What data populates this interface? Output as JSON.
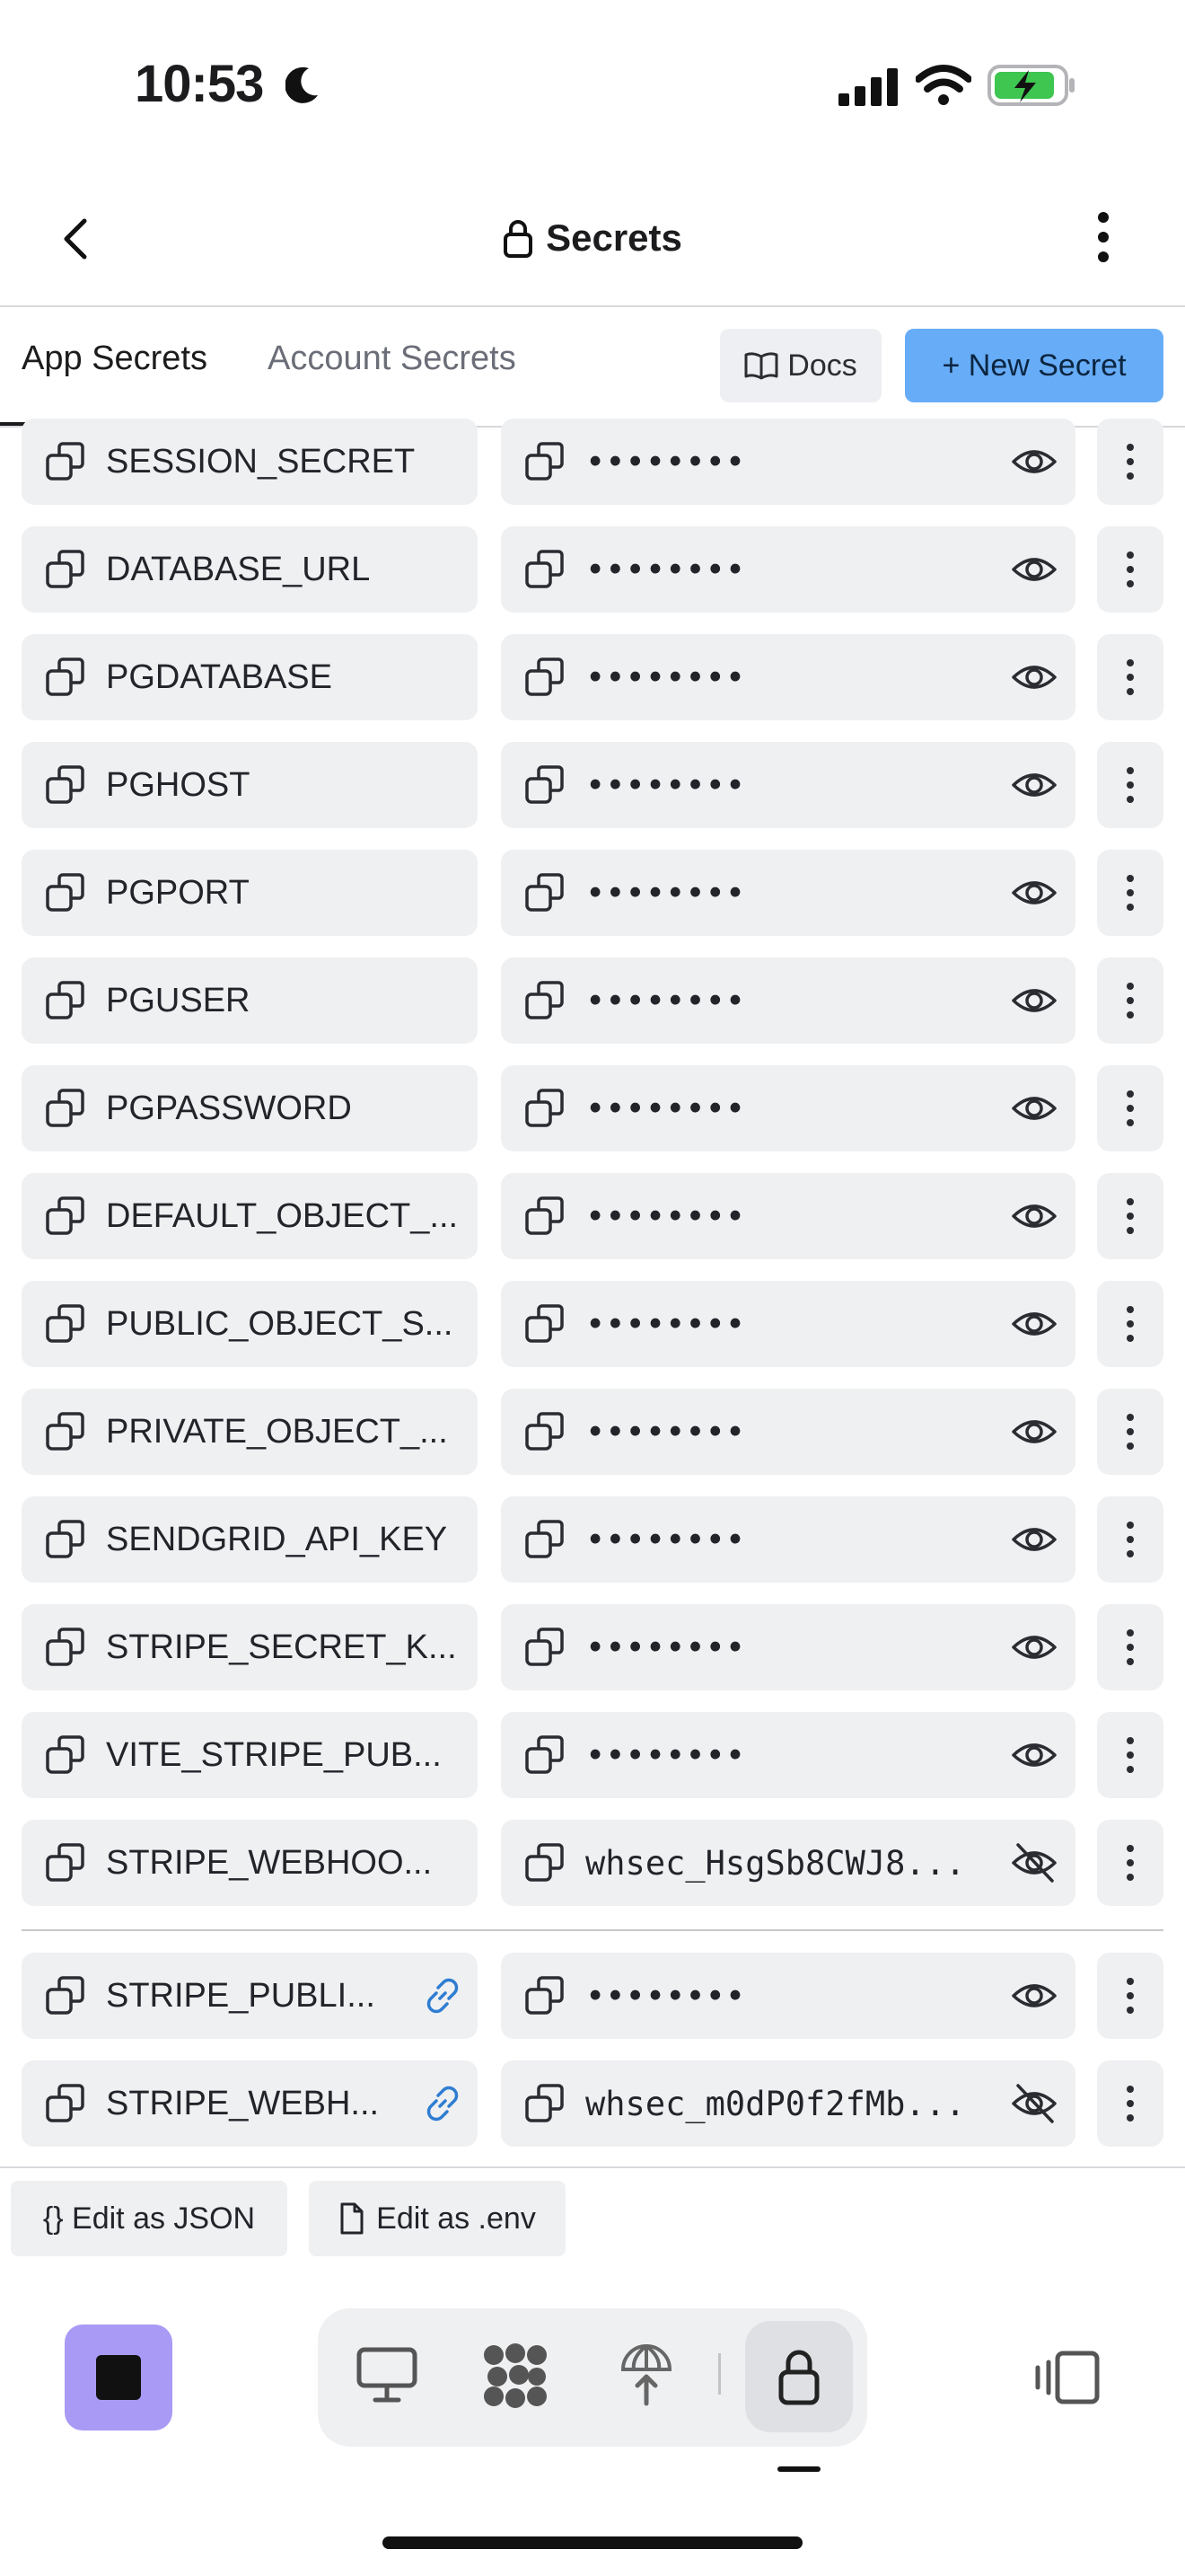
{
  "status": {
    "time": "10:53"
  },
  "header": {
    "title": "Secrets"
  },
  "tabs": [
    {
      "label": "App Secrets",
      "active": true
    },
    {
      "label": "Account Secrets",
      "active": false
    }
  ],
  "actions": {
    "docs_label": "Docs",
    "new_secret_label": "+ New Secret"
  },
  "secrets": [
    {
      "key": "SESSION_SECRET",
      "value": "••••••••",
      "visible": false
    },
    {
      "key": "DATABASE_URL",
      "value": "••••••••",
      "visible": false
    },
    {
      "key": "PGDATABASE",
      "value": "••••••••",
      "visible": false
    },
    {
      "key": "PGHOST",
      "value": "••••••••",
      "visible": false
    },
    {
      "key": "PGPORT",
      "value": "••••••••",
      "visible": false
    },
    {
      "key": "PGUSER",
      "value": "••••••••",
      "visible": false
    },
    {
      "key": "PGPASSWORD",
      "value": "••••••••",
      "visible": false
    },
    {
      "key": "DEFAULT_OBJECT_...",
      "value": "••••••••",
      "visible": false
    },
    {
      "key": "PUBLIC_OBJECT_S...",
      "value": "••••••••",
      "visible": false
    },
    {
      "key": "PRIVATE_OBJECT_...",
      "value": "••••••••",
      "visible": false
    },
    {
      "key": "SENDGRID_API_KEY",
      "value": "••••••••",
      "visible": false
    },
    {
      "key": "STRIPE_SECRET_K...",
      "value": "••••••••",
      "visible": false
    },
    {
      "key": "VITE_STRIPE_PUB...",
      "value": "••••••••",
      "visible": false
    },
    {
      "key": "STRIPE_WEBHOO...",
      "value": "whsec_HsgSb8CWJ8...",
      "visible": true
    }
  ],
  "linked_secrets": [
    {
      "key": "STRIPE_PUBLI...",
      "value": "••••••••",
      "visible": false
    },
    {
      "key": "STRIPE_WEBH...",
      "value": "whsec_m0dP0f2fMb...",
      "visible": true
    }
  ],
  "footer": {
    "edit_json_label": "{} Edit as JSON",
    "edit_env_label": "Edit as .env"
  },
  "colors": {
    "accent": "#67acf7",
    "stop": "#a99af5",
    "link": "#2f7dd1",
    "surface": "#eff0f2"
  }
}
